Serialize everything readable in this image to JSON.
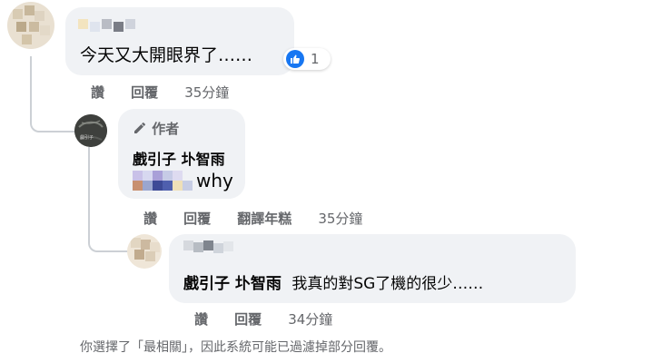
{
  "comments": [
    {
      "text": "今天又大開眼界了……",
      "reaction_count": "1",
      "actions": {
        "reply_like": "讚",
        "reply": "回覆",
        "time": "35分鐘"
      }
    },
    {
      "author_badge": "作者",
      "author_name": "戲引子 圤智雨",
      "text_suffix": "why",
      "avatar_caption": "戲引子",
      "actions": {
        "reply_like": "讚",
        "reply": "回覆",
        "translate": "翻譯年糕",
        "time": "35分鐘"
      }
    },
    {
      "mention": "戲引子 圤智雨",
      "text": "我真的對SG了機的很少……",
      "actions": {
        "reply_like": "讚",
        "reply": "回覆",
        "time": "34分鐘"
      }
    }
  ],
  "footer_note": "你選擇了「最相關」，因此系統可能已過濾掉部分回覆。",
  "colors": {
    "bubble": "#f0f2f5",
    "like_blue": "#1877f2",
    "muted": "#65676b"
  }
}
